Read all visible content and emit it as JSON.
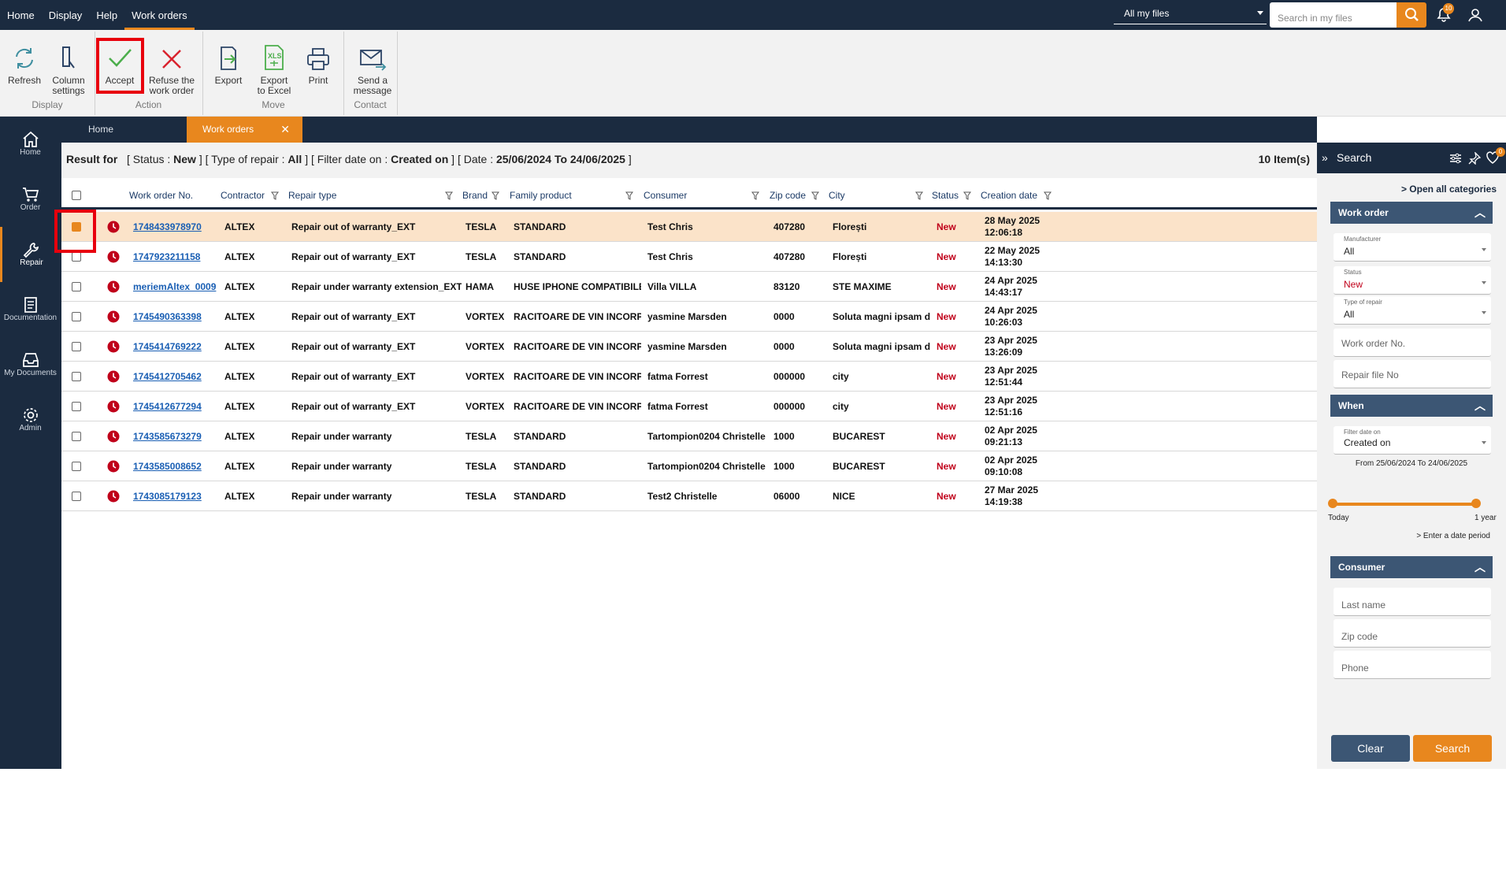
{
  "topnav": [
    "Home",
    "Display",
    "Help",
    "Work orders"
  ],
  "file_filter": "All my files",
  "search_placeholder": "Search in my files",
  "notifications_count": "10",
  "ribbon": {
    "refresh": "Refresh",
    "column_settings_1": "Column",
    "column_settings_2": "settings",
    "accept": "Accept",
    "refuse_1": "Refuse the",
    "refuse_2": "work order",
    "export": "Export",
    "export_excel_1": "Export",
    "export_excel_2": "to Excel",
    "print": "Print",
    "send_1": "Send a",
    "send_2": "message",
    "group_display": "Display",
    "group_action": "Action",
    "group_move": "Move",
    "group_contact": "Contact"
  },
  "leftnav": [
    "Home",
    "Order",
    "Repair",
    "Documentation",
    "My Documents",
    "Admin"
  ],
  "tabs": {
    "home": "Home",
    "workorders": "Work orders"
  },
  "result": {
    "prefix": "Result for",
    "status_label": "[ Status :",
    "status_value": "New",
    "repair_label": "]   [ Type of repair :",
    "repair_value": "All",
    "filter_label": "]   [ Filter date on :",
    "filter_value": "Created on",
    "date_label": "]   [ Date :",
    "date_value": "25/06/2024 To 24/06/2025",
    "close": "]",
    "count": "10 Item(s)"
  },
  "columns": [
    "Work order No.",
    "Contractor",
    "Repair type",
    "Brand",
    "Family product",
    "Consumer",
    "Zip code",
    "City",
    "Status",
    "Creation date"
  ],
  "rows": [
    {
      "no": "1748433978970",
      "contractor": "ALTEX",
      "repair": "Repair out of warranty_EXT",
      "brand": "TESLA",
      "family": "STANDARD",
      "consumer": "Test Chris",
      "zip": "407280",
      "city": "Florești",
      "status": "New",
      "date": "28 May 2025",
      "time": "12:06:18"
    },
    {
      "no": "1747923211158",
      "contractor": "ALTEX",
      "repair": "Repair out of warranty_EXT",
      "brand": "TESLA",
      "family": "STANDARD",
      "consumer": "Test Chris",
      "zip": "407280",
      "city": "Florești",
      "status": "New",
      "date": "22 May 2025",
      "time": "14:13:30"
    },
    {
      "no": "meriemAltex_0009",
      "contractor": "ALTEX",
      "repair": "Repair under warranty extension_EXT",
      "brand": "HAMA",
      "family": "HUSE IPHONE COMPATIBILE",
      "consumer": "Villa VILLA",
      "zip": "83120",
      "city": "STE MAXIME",
      "status": "New",
      "date": "24 Apr 2025",
      "time": "14:43:17"
    },
    {
      "no": "1745490363398",
      "contractor": "ALTEX",
      "repair": "Repair out of warranty_EXT",
      "brand": "VORTEX",
      "family": "RACITOARE DE VIN INCORP.",
      "consumer": "yasmine Marsden",
      "zip": "0000",
      "city": "Soluta magni ipsam d",
      "status": "New",
      "date": "24 Apr 2025",
      "time": "10:26:03"
    },
    {
      "no": "1745414769222",
      "contractor": "ALTEX",
      "repair": "Repair out of warranty_EXT",
      "brand": "VORTEX",
      "family": "RACITOARE DE VIN INCORP.",
      "consumer": "yasmine Marsden",
      "zip": "0000",
      "city": "Soluta magni ipsam d",
      "status": "New",
      "date": "23 Apr 2025",
      "time": "13:26:09"
    },
    {
      "no": "1745412705462",
      "contractor": "ALTEX",
      "repair": "Repair out of warranty_EXT",
      "brand": "VORTEX",
      "family": "RACITOARE DE VIN INCORP.",
      "consumer": "fatma Forrest",
      "zip": "000000",
      "city": "city",
      "status": "New",
      "date": "23 Apr 2025",
      "time": "12:51:44"
    },
    {
      "no": "1745412677294",
      "contractor": "ALTEX",
      "repair": "Repair out of warranty_EXT",
      "brand": "VORTEX",
      "family": "RACITOARE DE VIN INCORP.",
      "consumer": "fatma Forrest",
      "zip": "000000",
      "city": "city",
      "status": "New",
      "date": "23 Apr 2025",
      "time": "12:51:16"
    },
    {
      "no": "1743585673279",
      "contractor": "ALTEX",
      "repair": "Repair under warranty",
      "brand": "TESLA",
      "family": "STANDARD",
      "consumer": "Tartompion0204 Christelle",
      "zip": "1000",
      "city": "BUCAREST",
      "status": "New",
      "date": "02 Apr 2025",
      "time": "09:21:13"
    },
    {
      "no": "1743585008652",
      "contractor": "ALTEX",
      "repair": "Repair under warranty",
      "brand": "TESLA",
      "family": "STANDARD",
      "consumer": "Tartompion0204 Christelle",
      "zip": "1000",
      "city": "BUCAREST",
      "status": "New",
      "date": "02 Apr 2025",
      "time": "09:10:08"
    },
    {
      "no": "1743085179123",
      "contractor": "ALTEX",
      "repair": "Repair under warranty",
      "brand": "TESLA",
      "family": "STANDARD",
      "consumer": "Test2 Christelle",
      "zip": "06000",
      "city": "NICE",
      "status": "New",
      "date": "27 Mar 2025",
      "time": "14:19:38"
    }
  ],
  "panel": {
    "title": "Search",
    "badge": "0",
    "open_all": "> Open all categories",
    "sec_workorder": "Work order",
    "manufacturer_label": "Manufacturer",
    "manufacturer_value": "All",
    "status_label": "Status",
    "status_value": "New",
    "typerepair_label": "Type of repair",
    "typerepair_value": "All",
    "workorder_ph": "Work order No.",
    "repairfile_ph": "Repair file No",
    "sec_when": "When",
    "filterdate_label": "Filter date on",
    "filterdate_value": "Created on",
    "range": "From 25/06/2024 To 24/06/2025",
    "today": "Today",
    "year": "1 year",
    "enter_period": "> Enter a date period",
    "sec_consumer": "Consumer",
    "lastname_ph": "Last name",
    "zip_ph": "Zip code",
    "phone_ph": "Phone",
    "clear": "Clear",
    "search": "Search"
  },
  "colors": {
    "navy": "#1b2b40",
    "orange": "#e8871e",
    "highlight": "#e8000d",
    "status": "#c0001a"
  }
}
